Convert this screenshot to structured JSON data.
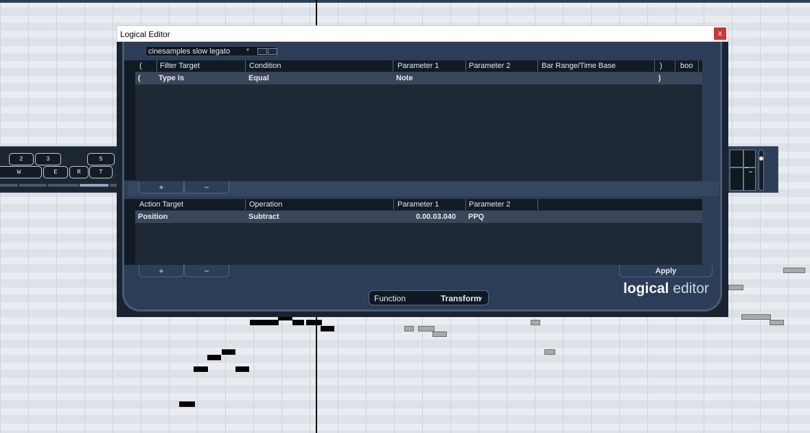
{
  "window": {
    "title": "Logical Editor",
    "close_label": "x"
  },
  "preset": {
    "name": "cinesamples slow legato",
    "arrow": "▾"
  },
  "filter_table": {
    "headers": [
      "(",
      "Filter Target",
      "Condition",
      "Parameter 1",
      "Parameter 2",
      "Bar Range/Time Base",
      ")",
      "boo"
    ],
    "rows": [
      {
        "open": "(",
        "target": "Type Is",
        "condition": "Equal",
        "param1": "Note",
        "param2": "",
        "range": "",
        "close": ")",
        "bool": ""
      }
    ]
  },
  "action_table": {
    "headers": [
      "Action Target",
      "Operation",
      "Parameter 1",
      "Parameter 2"
    ],
    "rows": [
      {
        "target": "Position",
        "operation": "Subtract",
        "param1": "0.00.03.040",
        "param2": "PPQ"
      }
    ]
  },
  "buttons": {
    "add": "+",
    "remove": "−",
    "apply": "Apply"
  },
  "function": {
    "label": "Function",
    "value": "Transform",
    "arrow": "▾"
  },
  "logo": {
    "bold": "logical",
    "light": "editor"
  },
  "keyboard": {
    "top_keys": [
      "2",
      "3",
      "5"
    ],
    "bottom_keys": [
      "W",
      "E",
      "R",
      "T"
    ]
  }
}
